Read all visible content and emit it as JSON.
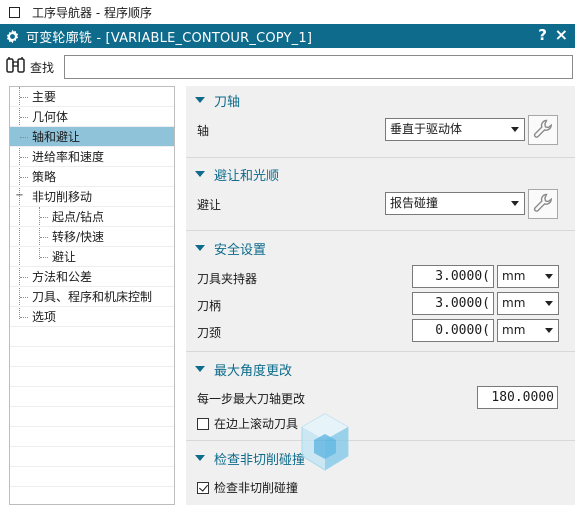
{
  "window": {
    "top_title": "工序导航器 - 程序顺序",
    "dialog_title": "可变轮廓铣 - [VARIABLE_CONTOUR_COPY_1]",
    "help_label": "?",
    "close_label": "×"
  },
  "find": {
    "label": "查找",
    "value": ""
  },
  "nav": {
    "items": [
      {
        "label": "主要",
        "selected": false
      },
      {
        "label": "几何体",
        "selected": false
      },
      {
        "label": "轴和避让",
        "selected": true
      },
      {
        "label": "进给率和速度",
        "selected": false
      },
      {
        "label": "策略",
        "selected": false
      },
      {
        "label": "非切削移动",
        "selected": false
      },
      {
        "label": "起点/钻点",
        "selected": false
      },
      {
        "label": "转移/快速",
        "selected": false
      },
      {
        "label": "避让",
        "selected": false
      },
      {
        "label": "方法和公差",
        "selected": false
      },
      {
        "label": "刀具、程序和机床控制",
        "selected": false
      },
      {
        "label": "选项",
        "selected": false
      }
    ],
    "collapse_symbol": "−"
  },
  "sections": {
    "tool_axis": {
      "title": "刀轴",
      "axis_label": "轴",
      "axis_value": "垂直于驱动体"
    },
    "avoid": {
      "title": "避让和光顺",
      "avoid_label": "避让",
      "avoid_value": "报告碰撞"
    },
    "safety": {
      "title": "安全设置",
      "holder_label": "刀具夹持器",
      "holder_value": "3.0000(",
      "holder_unit": "mm",
      "shank_label": "刀柄",
      "shank_value": "3.0000(",
      "shank_unit": "mm",
      "neck_label": "刀颈",
      "neck_value": "0.0000(",
      "neck_unit": "mm"
    },
    "max_angle": {
      "title": "最大角度更改",
      "step_label": "每一步最大刀轴更改",
      "step_value": "180.0000",
      "roll_label": "在边上滚动刀具",
      "roll_checked": false
    },
    "check": {
      "title": "检查非切削碰撞",
      "check_label": "检查非切削碰撞",
      "check_checked": true
    }
  },
  "colors": {
    "title_bar": "#0e6b8c",
    "accent_text": "#0e6b8c",
    "selection": "#8ec3d9"
  },
  "icons": {
    "window": "window-icon",
    "settings": "gear-icon",
    "find": "binoculars-icon",
    "edit": "wrench-icon"
  }
}
